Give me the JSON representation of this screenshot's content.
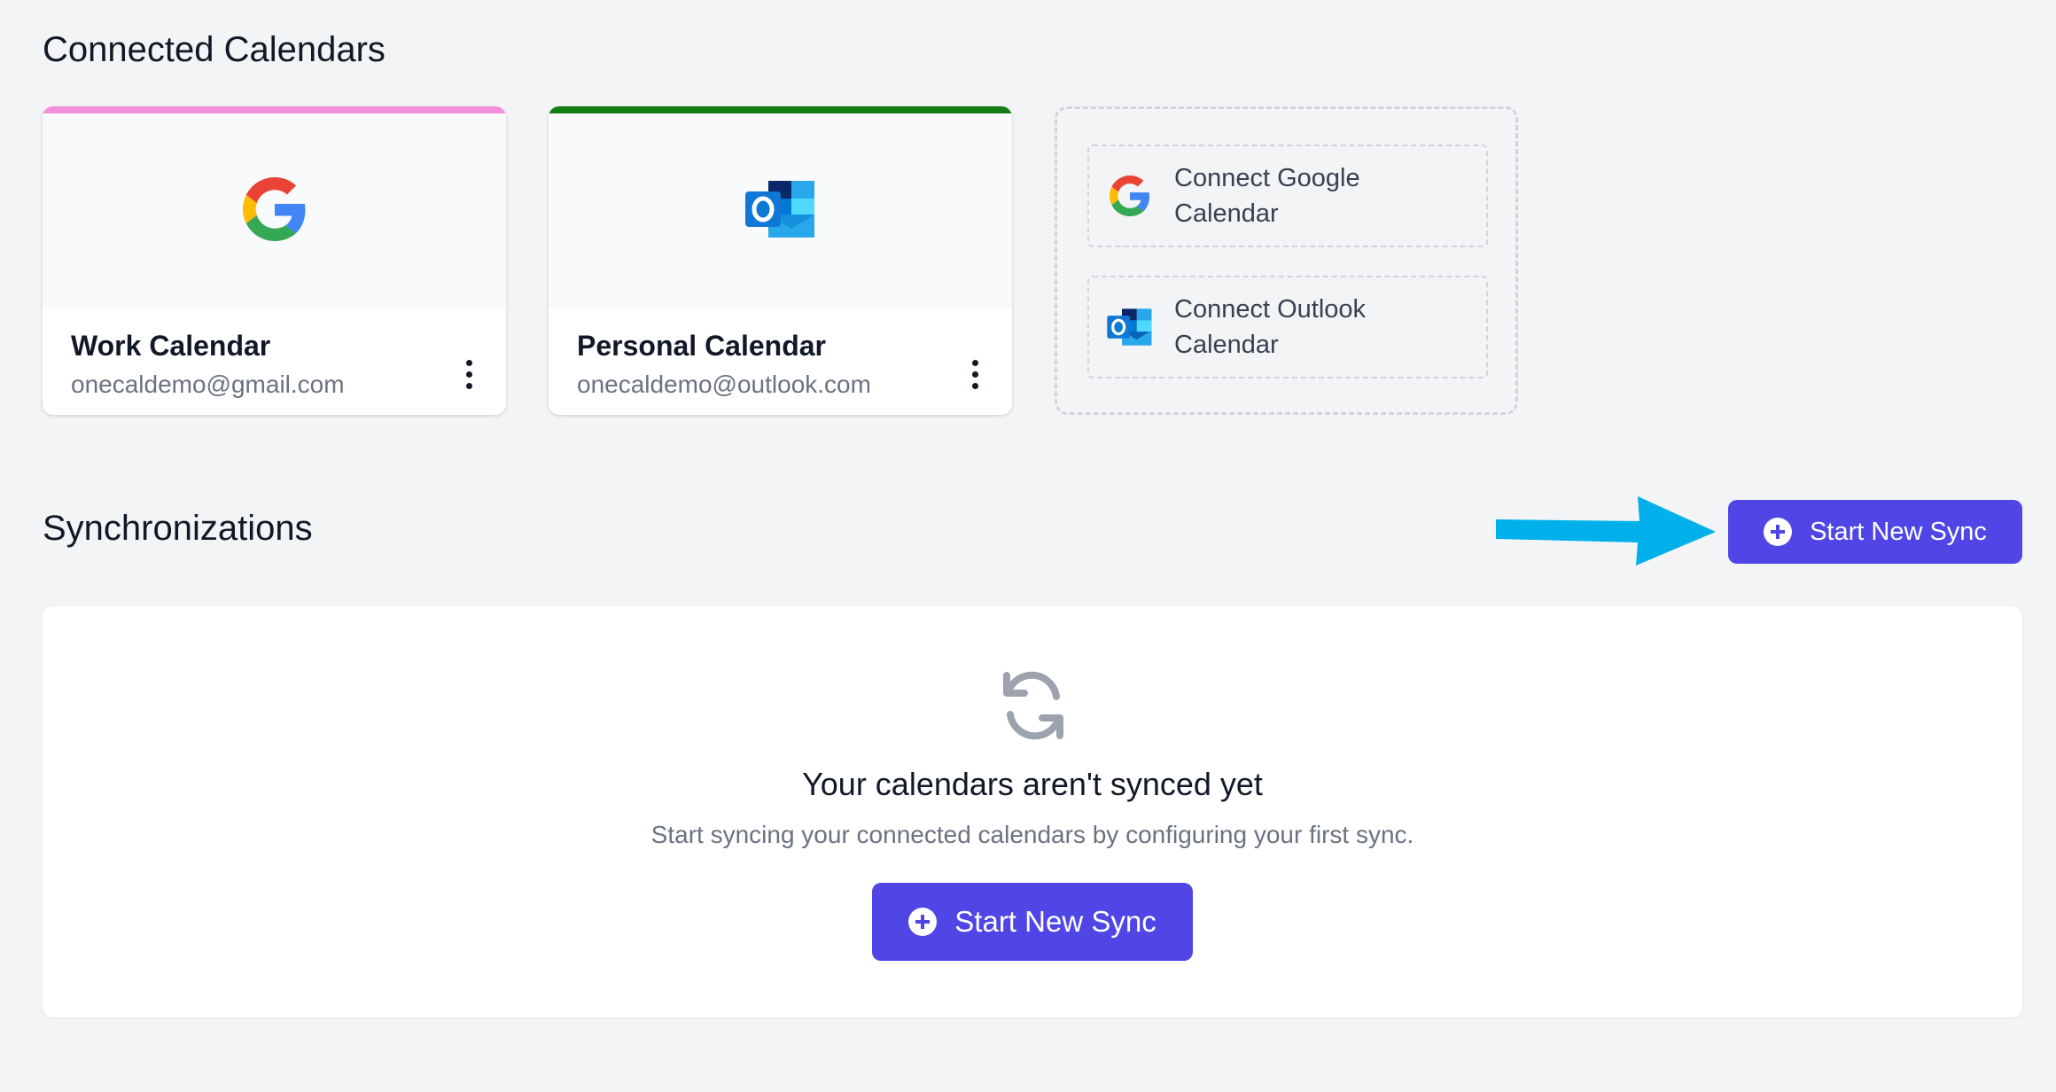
{
  "connected_section": {
    "title": "Connected Calendars",
    "cards": [
      {
        "name": "Work Calendar",
        "email": "onecaldemo@gmail.com",
        "provider": "google-icon",
        "accent": "#f38fd8"
      },
      {
        "name": "Personal Calendar",
        "email": "onecaldemo@outlook.com",
        "provider": "outlook-icon",
        "accent": "#137d14"
      }
    ],
    "connect_google_label": "Connect Google Calendar",
    "connect_outlook_label": "Connect Outlook Calendar"
  },
  "sync_section": {
    "title": "Synchronizations",
    "start_button_label": "Start New Sync",
    "empty_title": "Your calendars aren't synced yet",
    "empty_subtitle": "Start syncing your connected calendars by configuring your first sync.",
    "empty_button_label": "Start New Sync",
    "empty_icon": "sync-icon"
  },
  "colors": {
    "primary": "#4f46e5",
    "arrow": "#00b0ea",
    "background": "#f3f4f6"
  }
}
